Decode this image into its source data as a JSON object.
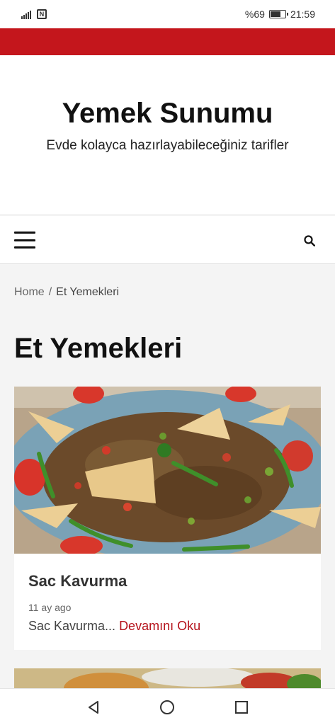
{
  "status_bar": {
    "battery": "%69",
    "battery_level": 0.69,
    "time": "21:59",
    "icons": [
      "signal-icon",
      "nfc-icon",
      "battery-icon"
    ]
  },
  "site": {
    "title": "Yemek Sunumu",
    "tagline": "Evde kolayca hazırlayabileceğiniz tarifler",
    "accent_color": "#c4161c"
  },
  "nav": {
    "icons": [
      "menu-icon",
      "search-icon"
    ]
  },
  "breadcrumb": {
    "home": "Home",
    "separator": "/",
    "current": "Et Yemekleri"
  },
  "page": {
    "title": "Et Yemekleri"
  },
  "posts": [
    {
      "title": "Sac Kavurma",
      "date": "11 ay ago",
      "excerpt": "Sac Kavurma...",
      "read_more": "Devamını Oku"
    }
  ],
  "system_nav": {
    "icons": [
      "back-icon",
      "home-icon",
      "recents-icon"
    ]
  }
}
